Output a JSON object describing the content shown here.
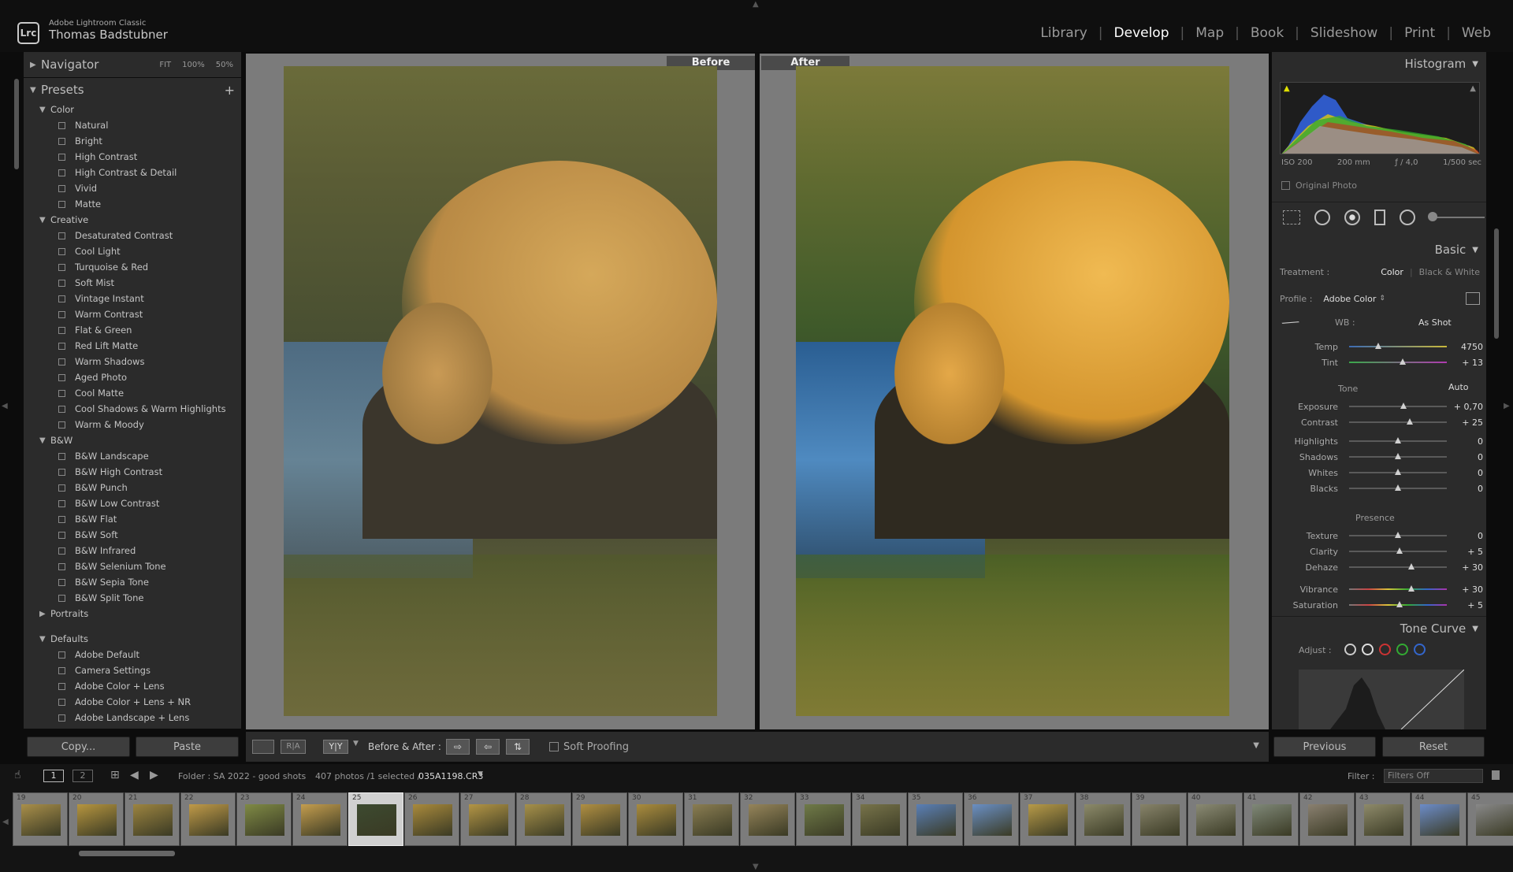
{
  "app": {
    "name": "Adobe Lightroom Classic",
    "logo": "Lrc",
    "user": "Thomas Badstubner"
  },
  "modules": [
    {
      "label": "Library",
      "active": false
    },
    {
      "label": "Develop",
      "active": true
    },
    {
      "label": "Map",
      "active": false
    },
    {
      "label": "Book",
      "active": false
    },
    {
      "label": "Slideshow",
      "active": false
    },
    {
      "label": "Print",
      "active": false
    },
    {
      "label": "Web",
      "active": false
    }
  ],
  "navigator": {
    "title": "Navigator",
    "zoom_options": [
      "FIT",
      "100%",
      "50%"
    ]
  },
  "presets": {
    "title": "Presets",
    "groups": [
      {
        "name": "Color",
        "expanded": true,
        "items": [
          "Natural",
          "Bright",
          "High Contrast",
          "High Contrast & Detail",
          "Vivid",
          "Matte"
        ]
      },
      {
        "name": "Creative",
        "expanded": true,
        "items": [
          "Desaturated Contrast",
          "Cool Light",
          "Turquoise & Red",
          "Soft Mist",
          "Vintage Instant",
          "Warm Contrast",
          "Flat & Green",
          "Red Lift Matte",
          "Warm Shadows",
          "Aged Photo",
          "Cool Matte",
          "Cool Shadows & Warm Highlights",
          "Warm & Moody"
        ]
      },
      {
        "name": "B&W",
        "expanded": true,
        "items": [
          "B&W Landscape",
          "B&W High Contrast",
          "B&W Punch",
          "B&W Low Contrast",
          "B&W Flat",
          "B&W Soft",
          "B&W Infrared",
          "B&W Selenium Tone",
          "B&W Sepia Tone",
          "B&W Split Tone"
        ]
      },
      {
        "name": "Portraits",
        "expanded": false,
        "items": []
      },
      {
        "name": "Defaults",
        "expanded": true,
        "items": [
          "Adobe Default",
          "Camera Settings",
          "Adobe Color + Lens",
          "Adobe Color + Lens + NR",
          "Adobe Landscape + Lens"
        ]
      }
    ]
  },
  "left_buttons": {
    "copy": "Copy...",
    "paste": "Paste"
  },
  "view": {
    "before_label": "Before",
    "after_label": "After"
  },
  "toolbar": {
    "before_after_label": "Before & After :",
    "soft_proofing_label": "Soft Proofing"
  },
  "histogram": {
    "title": "Histogram",
    "iso": "ISO 200",
    "focal": "200 mm",
    "aperture": "ƒ / 4,0",
    "shutter": "1/500 sec",
    "original_photo_label": "Original Photo"
  },
  "basic": {
    "title": "Basic",
    "treatment_label": "Treatment :",
    "treatment_color": "Color",
    "treatment_bw": "Black & White",
    "profile_label": "Profile :",
    "profile_value": "Adobe Color",
    "wb_label": "WB :",
    "wb_value": "As Shot",
    "tone_label": "Tone",
    "auto_label": "Auto",
    "presence_label": "Presence",
    "sliders": {
      "temp": {
        "label": "Temp",
        "value": "4750",
        "pos": 0.3
      },
      "tint": {
        "label": "Tint",
        "value": "+ 13",
        "pos": 0.55
      },
      "exposure": {
        "label": "Exposure",
        "value": "+ 0,70",
        "pos": 0.56
      },
      "contrast": {
        "label": "Contrast",
        "value": "+ 25",
        "pos": 0.62
      },
      "highlights": {
        "label": "Highlights",
        "value": "0",
        "pos": 0.5
      },
      "shadows": {
        "label": "Shadows",
        "value": "0",
        "pos": 0.5
      },
      "whites": {
        "label": "Whites",
        "value": "0",
        "pos": 0.5
      },
      "blacks": {
        "label": "Blacks",
        "value": "0",
        "pos": 0.5
      },
      "texture": {
        "label": "Texture",
        "value": "0",
        "pos": 0.5
      },
      "clarity": {
        "label": "Clarity",
        "value": "+ 5",
        "pos": 0.52
      },
      "dehaze": {
        "label": "Dehaze",
        "value": "+ 30",
        "pos": 0.64
      },
      "vibrance": {
        "label": "Vibrance",
        "value": "+ 30",
        "pos": 0.64
      },
      "saturation": {
        "label": "Saturation",
        "value": "+ 5",
        "pos": 0.52
      }
    }
  },
  "tone_curve": {
    "title": "Tone Curve",
    "adjust_label": "Adjust :"
  },
  "right_buttons": {
    "previous": "Previous",
    "reset": "Reset"
  },
  "filmstrip": {
    "screen_1": "1",
    "screen_2": "2",
    "source": "Folder : SA 2022 - good shots",
    "count": "407 photos /1 selected /",
    "filename": "035A1198.CR3",
    "filter_label": "Filter :",
    "filter_value": "Filters Off",
    "thumbnails": [
      "19",
      "20",
      "21",
      "22",
      "23",
      "24",
      "25",
      "26",
      "27",
      "28",
      "29",
      "30",
      "31",
      "32",
      "33",
      "34",
      "35",
      "36",
      "37",
      "38",
      "39",
      "40",
      "41",
      "42",
      "43",
      "44",
      "45"
    ],
    "selected": "25"
  }
}
